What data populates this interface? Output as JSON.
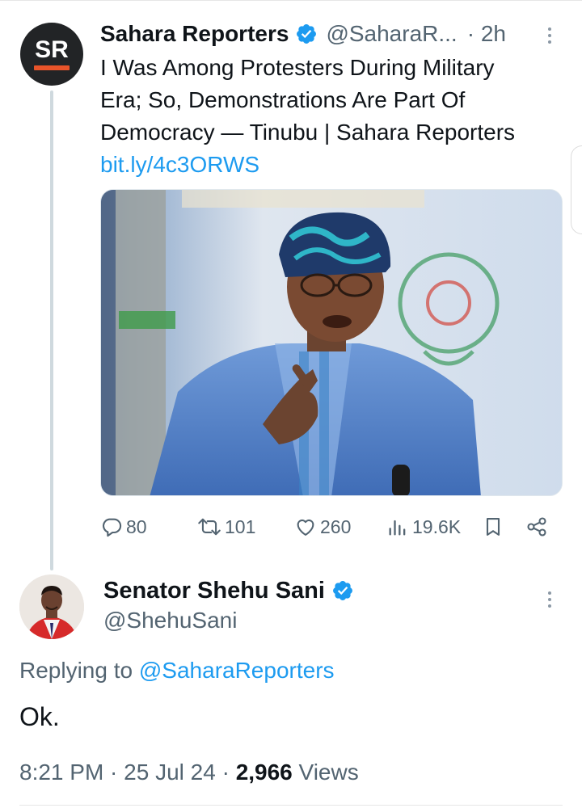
{
  "parent_tweet": {
    "avatar_text": "SR",
    "author_name": "Sahara Reporters",
    "handle": "@SaharaR...",
    "time": "· 2h",
    "text_lines": [
      "I Was Among Protesters During Military",
      "Era; So, Demonstrations Are Part Of",
      "Democracy — Tinubu | Sahara Reporters"
    ],
    "link": "bit.ly/4c3ORWS",
    "stats": {
      "replies": "80",
      "reposts": "101",
      "likes": "260",
      "views": "19.6K"
    }
  },
  "reply_tweet": {
    "author_name": "Senator Shehu Sani",
    "handle": "@ShehuSani",
    "replying_prefix": "Replying to",
    "replying_to": "@SaharaReporters",
    "text": "Ok.",
    "timestamp": "8:21 PM · 25 Jul 24 · ",
    "views_count": "2,966",
    "views_label": " Views"
  },
  "colors": {
    "accent": "#1d9bf0",
    "secondary_text": "#536471",
    "primary_text": "#0f1419",
    "sr_brand_orange": "#e8542a"
  },
  "icons": [
    "verified-badge-icon",
    "more-options-icon",
    "reply-icon",
    "repost-icon",
    "like-icon",
    "views-icon",
    "bookmark-icon",
    "share-icon"
  ]
}
